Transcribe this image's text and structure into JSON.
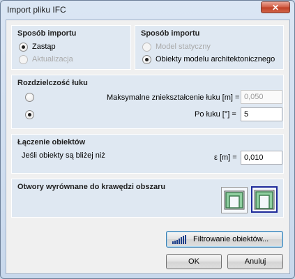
{
  "window": {
    "title": "Import pliku IFC",
    "close_glyph": "✕"
  },
  "import_mode": {
    "title": "Sposób importu",
    "options": [
      {
        "label": "Zastąp",
        "checked": true,
        "disabled": false
      },
      {
        "label": "Aktualizacja",
        "checked": false,
        "disabled": true
      }
    ]
  },
  "import_model": {
    "title": "Sposób importu",
    "options": [
      {
        "label": "Model statyczny",
        "checked": false,
        "disabled": true
      },
      {
        "label": "Obiekty modelu architektonicznego",
        "checked": true,
        "disabled": false
      }
    ]
  },
  "arc_resolution": {
    "title": "Rozdzielczość łuku",
    "max_distortion_label": "Maksymalne zniekształcenie łuku [m] =",
    "max_distortion_value": "0,050",
    "arc_angle_label": "Po łuku [°] =",
    "arc_angle_value": "5"
  },
  "merge": {
    "title": "Łączenie obiektów",
    "description": "Jeśli obiekty są bliżej niż",
    "epsilon_label": "ε [m] =",
    "epsilon_value": "0,010"
  },
  "openings": {
    "title": "Otwory wyrównane do krawędzi obszaru",
    "selected_option": 2
  },
  "buttons": {
    "filter": "Filtrowanie obiektów...",
    "ok": "OK",
    "cancel": "Anuluj"
  },
  "icons": [
    "close-icon",
    "filter-icon",
    "opening-flush-icon",
    "opening-aligned-icon"
  ],
  "colors": {
    "accent": "#3c7fb1",
    "group_bg": "#dfe8f2",
    "close": "#c03f24",
    "thumb_selected": "#1e2a9a"
  }
}
